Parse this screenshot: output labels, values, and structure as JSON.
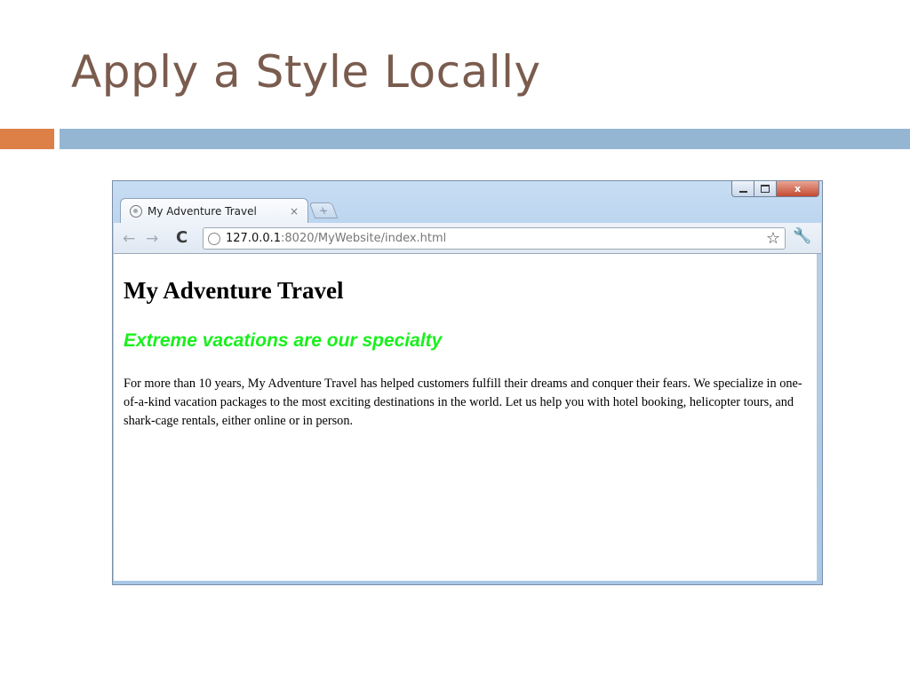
{
  "slide": {
    "title": "Apply a Style Locally",
    "colors": {
      "title": "#7a5c4e",
      "accent_orange": "#dd8047",
      "accent_blue": "#94b6d2"
    }
  },
  "browser": {
    "tab": {
      "title": "My Adventure Travel",
      "close_glyph": "×",
      "favicon": "globe-icon"
    },
    "new_tab_glyph": "+",
    "window_controls": {
      "minimize": "minimize-icon",
      "maximize": "maximize-icon",
      "close": "x"
    },
    "toolbar": {
      "back_glyph": "←",
      "forward_glyph": "→",
      "reload_glyph": "C",
      "url_host": "127.0.0.1",
      "url_path": ":8020/MyWebsite/index.html",
      "star_glyph": "☆",
      "wrench_glyph": "🔧"
    }
  },
  "page": {
    "heading": "My Adventure Travel",
    "subheading": "Extreme vacations are our specialty",
    "paragraph": "For more than 10 years, My Adventure Travel has helped customers fulfill their dreams and conquer their fears. We specialize in one-of-a-kind vacation packages to the most exciting destinations in the world. Let us help you with hotel booking, helicopter tours, and shark-cage rentals, either online or in person.",
    "colors": {
      "subheading": "#19f01c"
    }
  }
}
